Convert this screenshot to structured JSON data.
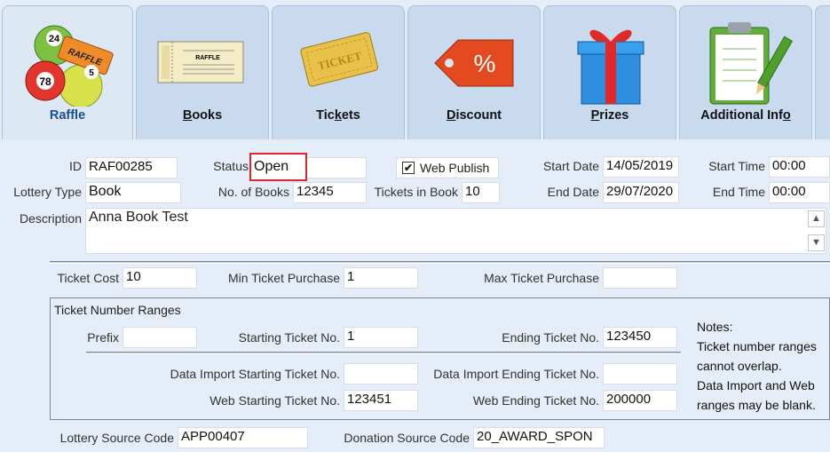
{
  "tabs": [
    {
      "key": "raffle",
      "label": "Raffle",
      "accel": "",
      "active": true
    },
    {
      "key": "books",
      "label": "ooks",
      "accel": "B",
      "active": false
    },
    {
      "key": "tickets",
      "label": "Tic",
      "accel": "k",
      "tail": "ets",
      "active": false
    },
    {
      "key": "discount",
      "label": "iscount",
      "accel": "D",
      "active": false
    },
    {
      "key": "prizes",
      "label": "rizes",
      "accel": "P",
      "active": false
    },
    {
      "key": "additional",
      "label": "Additional Inf",
      "accel": "o",
      "active": false
    }
  ],
  "tab_art": {
    "raffle_ball_numbers": [
      "24",
      "78",
      "5"
    ],
    "raffle_ticket_text": "RAFFLE",
    "book_title": "RAFFLE",
    "ticket_text": "TICKET",
    "discount_symbol": "%"
  },
  "form": {
    "id_label": "ID",
    "id_value": "RAF00285",
    "status_label": "Status",
    "status_value": "Open",
    "web_publish_label": "Web Publish",
    "web_publish_checked": "✔",
    "start_date_label": "Start Date",
    "start_date_value": "14/05/2019",
    "start_time_label": "Start Time",
    "start_time_value": "00:00",
    "lottery_type_label": "Lottery Type",
    "lottery_type_value": "Book",
    "num_books_label": "No. of Books",
    "num_books_value": "12345",
    "tickets_in_book_label": "Tickets in Book",
    "tickets_in_book_value": "10",
    "end_date_label": "End Date",
    "end_date_value": "29/07/2020",
    "end_time_label": "End Time",
    "end_time_value": "00:00",
    "description_label": "Description",
    "description_value": "Anna Book Test",
    "ticket_cost_label": "Ticket Cost",
    "ticket_cost_value": "10",
    "min_purchase_label": "Min Ticket Purchase",
    "min_purchase_value": "1",
    "max_purchase_label": "Max Ticket Purchase",
    "max_purchase_value": "",
    "ranges_title": "Ticket Number Ranges",
    "prefix_label": "Prefix",
    "prefix_value": "",
    "starting_label": "Starting Ticket No.",
    "starting_value": "1",
    "ending_label": "Ending Ticket No.",
    "ending_value": "123450",
    "di_start_label": "Data Import Starting Ticket No.",
    "di_start_value": "",
    "di_end_label": "Data Import Ending Ticket No.",
    "di_end_value": "",
    "web_start_label": "Web Starting Ticket No.",
    "web_start_value": "123451",
    "web_end_label": "Web Ending Ticket No.",
    "web_end_value": "200000",
    "notes": [
      "Notes:",
      "Ticket number ranges",
      "cannot overlap.",
      "Data Import and Web",
      "ranges may be blank."
    ],
    "lottery_source_label": "Lottery Source Code",
    "lottery_source_value": "APP00407",
    "donation_source_label": "Donation Source Code",
    "donation_source_value": "20_AWARD_SPON"
  },
  "colors": {
    "highlight": "#e0262a",
    "active_tab_text": "#1a4f91",
    "background": "#e5edf8"
  }
}
